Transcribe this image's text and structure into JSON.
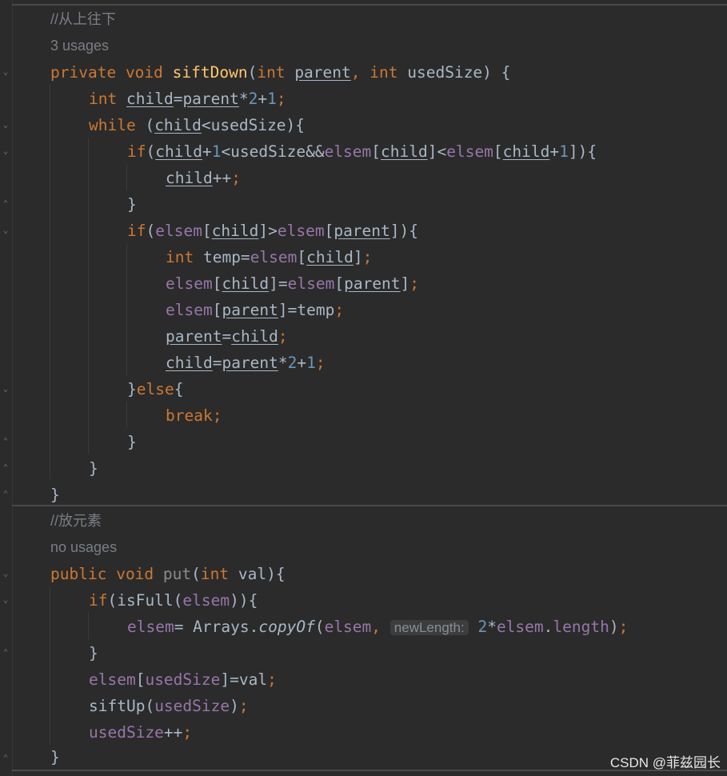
{
  "method1": {
    "comment": "//从上往下",
    "usages": "3 usages",
    "sig": {
      "private": "private",
      "void": "void",
      "name": "siftDown",
      "paren": "(",
      "int1": "int",
      "p1": "parent",
      "comma": ",",
      "int2": "int",
      "p2": "usedSize",
      "close": ") {"
    },
    "l1": {
      "int": "int",
      "child": "child",
      "eq": "=",
      "parent": "parent",
      "op1": "*",
      "n2": "2",
      "op2": "+",
      "n1": "1",
      "semi": ";"
    },
    "l2": {
      "while": "while",
      "open": " (",
      "child": "child",
      "lt": "<usedSize){"
    },
    "l3": {
      "if": "if",
      "open": "(",
      "child1": "child",
      "plus": "+",
      "n1": "1",
      "mid": "<usedSize&&",
      "elsem1": "elsem",
      "br1": "[",
      "child2": "child",
      "br2": "]<",
      "elsem2": "elsem",
      "br3": "[",
      "child3": "child",
      "plus2": "+",
      "n1b": "1",
      "end": "]){"
    },
    "l4": {
      "child": "child",
      "inc": "++",
      "semi": ";"
    },
    "l5": "}",
    "l6": {
      "if": "if",
      "open": "(",
      "elsem1": "elsem",
      "br1": "[",
      "child": "child",
      "br2": "]>",
      "elsem2": "elsem",
      "br3": "[",
      "parent": "parent",
      "end": "]){"
    },
    "l7": {
      "int": "int",
      "rest": " temp=",
      "elsem": "elsem",
      "br1": "[",
      "child": "child",
      "br2": "]",
      "semi": ";"
    },
    "l8": {
      "elsem1": "elsem",
      "br1": "[",
      "child": "child",
      "br2": "]=",
      "elsem2": "elsem",
      "br3": "[",
      "parent": "parent",
      "br4": "]",
      "semi": ";"
    },
    "l9": {
      "elsem": "elsem",
      "br1": "[",
      "parent": "parent",
      "br2": "]=temp",
      "semi": ";"
    },
    "l10": {
      "parent": "parent",
      "eq": "=",
      "child": "child",
      "semi": ";"
    },
    "l11": {
      "child": "child",
      "eq": "=",
      "parent": "parent",
      "op1": "*",
      "n2": "2",
      "op2": "+",
      "n1": "1",
      "semi": ";"
    },
    "l12": {
      "brace": "}",
      "else": "else",
      "open": "{"
    },
    "l13": {
      "break": "break",
      "semi": ";"
    },
    "l14": "}",
    "l15": "}",
    "l16": "}"
  },
  "method2": {
    "comment": "//放元素",
    "usages": "no usages",
    "sig": {
      "public": "public",
      "void": "void",
      "name": "put",
      "open": "(",
      "int": "int",
      "rest": " val){"
    },
    "l1": {
      "if": "if",
      "rest": "(isFull(",
      "elsem": "elsem",
      "close": ")){"
    },
    "l2": {
      "elsem1": "elsem",
      "eq": "= Arrays.",
      "copyOf": "copyOf",
      "open": "(",
      "elsem2": "elsem",
      "comma": ",",
      "hint": "newLength:",
      "n2": "2",
      "star": "*",
      "elsem3": "elsem",
      "dot": ".",
      "length": "length",
      "close": ")",
      "semi": ";"
    },
    "l3": "}",
    "l4": {
      "elsem": "elsem",
      "br1": "[",
      "usedSize": "usedSize",
      "br2": "]=val",
      "semi": ";"
    },
    "l5": {
      "fn": "siftUp(",
      "usedSize": "usedSize",
      "close": ")",
      "semi": ";"
    },
    "l6": {
      "usedSize": "usedSize",
      "inc": "++",
      "semi": ";"
    },
    "l7": "}"
  },
  "watermark": "CSDN @菲兹园长",
  "colors": {
    "background": "#2b2b2b",
    "keyword": "#cc7832",
    "function": "#ffc66d",
    "number": "#6897bb",
    "field": "#9876aa",
    "text": "#a9b7c6"
  }
}
